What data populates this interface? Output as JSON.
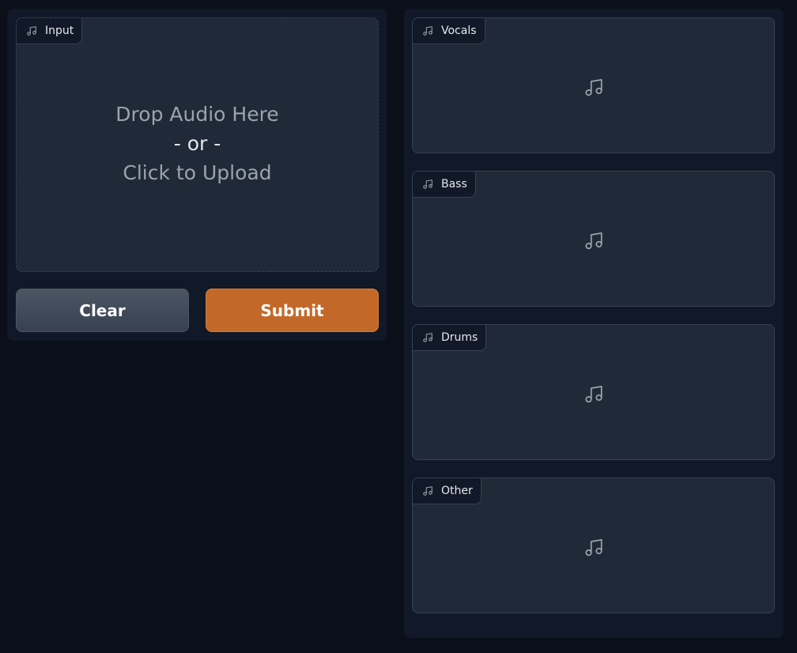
{
  "input": {
    "label": "Input",
    "drop_text": "Drop Audio Here",
    "or_text": "- or -",
    "click_text": "Click to Upload",
    "icon": "music-note-icon"
  },
  "buttons": {
    "clear_label": "Clear",
    "submit_label": "Submit",
    "submit_color": "#c2692a"
  },
  "outputs": [
    {
      "label": "Vocals",
      "icon": "music-note-icon"
    },
    {
      "label": "Bass",
      "icon": "music-note-icon"
    },
    {
      "label": "Drums",
      "icon": "music-note-icon"
    },
    {
      "label": "Other",
      "icon": "music-note-icon"
    }
  ],
  "colors": {
    "background": "#0b0f19",
    "panel": "#111827",
    "block": "#1f2937",
    "border": "#374151"
  }
}
